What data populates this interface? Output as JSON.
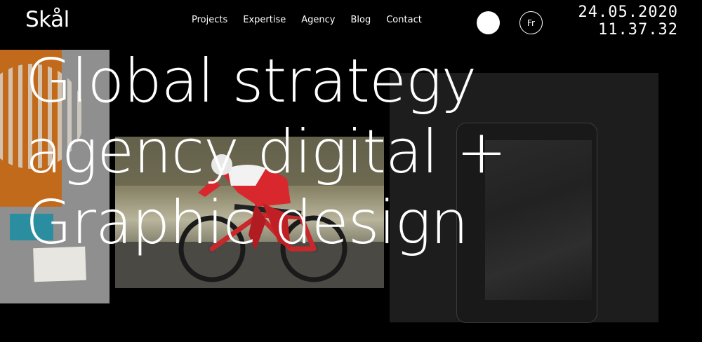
{
  "brand": {
    "logo": "Skål"
  },
  "nav": {
    "items": [
      {
        "label": "Projects"
      },
      {
        "label": "Expertise"
      },
      {
        "label": "Agency"
      },
      {
        "label": "Blog"
      },
      {
        "label": "Contact"
      }
    ]
  },
  "controls": {
    "language_label": "Fr"
  },
  "clock": {
    "date": "24.05.2020",
    "time": "11.37.32"
  },
  "hero": {
    "lines": [
      "Global strategy",
      "agency digital +",
      "Graphic design"
    ]
  },
  "colors": {
    "background": "#000000",
    "text": "#ffffff",
    "accent_orange": "#c26a1c",
    "accent_teal": "#2a8ea0"
  }
}
